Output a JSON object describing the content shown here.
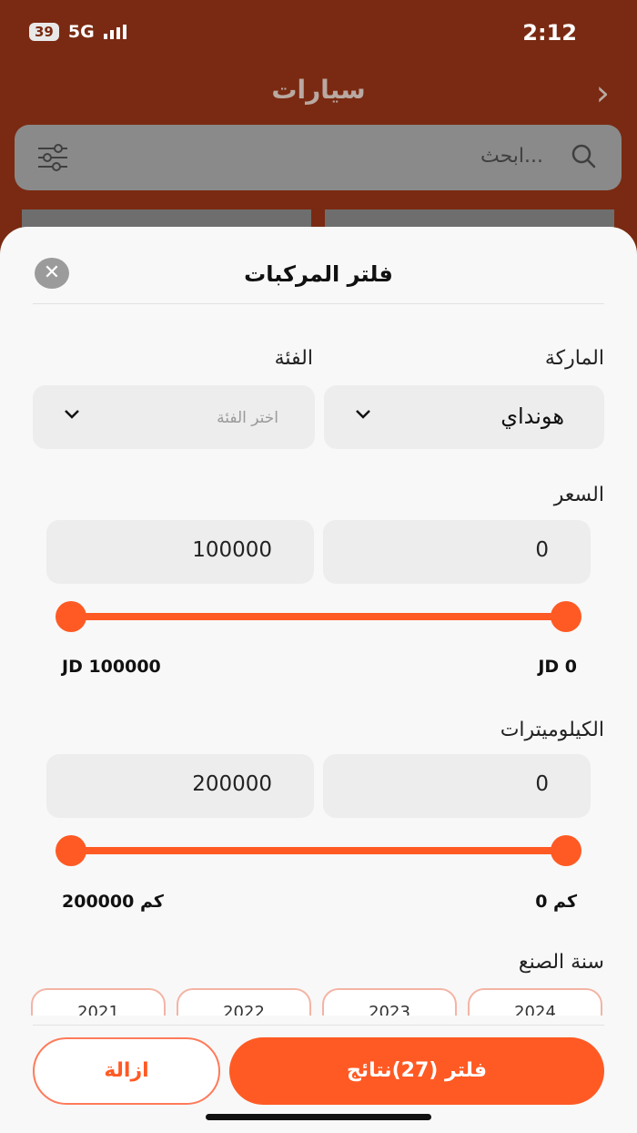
{
  "status_bar": {
    "battery": "39",
    "network": "5G",
    "time": "2:12"
  },
  "app_bar": {
    "title": "سيارات"
  },
  "search": {
    "placeholder": "ابحث..."
  },
  "filter_sheet": {
    "title": "فلتر المركبات",
    "brand": {
      "label": "الماركة",
      "value": "هونداي"
    },
    "category": {
      "label": "الفئة",
      "placeholder": "اختر الفئة"
    },
    "price": {
      "label": "السعر",
      "min_value": "0",
      "max_value": "100000",
      "min_label": "JD 0",
      "max_label": "JD 100000",
      "range": [
        0,
        100000
      ]
    },
    "kilometers": {
      "label": "الكيلوميترات",
      "min_value": "0",
      "max_value": "200000",
      "min_label": "0 كم",
      "max_label": "200000 كم",
      "range": [
        0,
        200000
      ]
    },
    "year": {
      "label": "سنة الصنع",
      "options": [
        "2024",
        "2023",
        "2022",
        "2021"
      ]
    },
    "apply_label": "فلتر (27)نتائج",
    "clear_label": "ازالة"
  },
  "colors": {
    "accent": "#ff5a24",
    "header": "#7a2a12"
  },
  "icons": [
    "search-icon",
    "filter-settings-icon",
    "chevron-right-icon",
    "close-icon",
    "chevron-down-icon"
  ]
}
